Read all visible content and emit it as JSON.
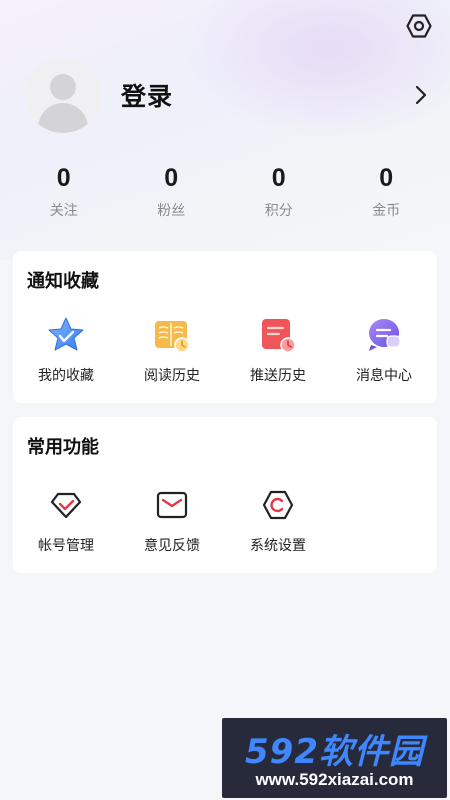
{
  "profile": {
    "login_label": "登录"
  },
  "stats": [
    {
      "value": "0",
      "label": "关注"
    },
    {
      "value": "0",
      "label": "粉丝"
    },
    {
      "value": "0",
      "label": "积分"
    },
    {
      "value": "0",
      "label": "金币"
    }
  ],
  "notify_section": {
    "title": "通知收藏",
    "items": [
      {
        "label": "我的收藏",
        "icon": "star-icon"
      },
      {
        "label": "阅读历史",
        "icon": "book-icon"
      },
      {
        "label": "推送历史",
        "icon": "push-history-icon"
      },
      {
        "label": "消息中心",
        "icon": "message-icon"
      }
    ]
  },
  "common_section": {
    "title": "常用功能",
    "items": [
      {
        "label": "帐号管理",
        "icon": "account-icon"
      },
      {
        "label": "意见反馈",
        "icon": "feedback-mail-icon"
      },
      {
        "label": "系统设置",
        "icon": "settings-hex-icon"
      }
    ]
  },
  "watermark": {
    "brand": "592软件园",
    "url": "www.592xiazai.com"
  },
  "colors": {
    "accent": "#e03a4a",
    "background": "#f5f6f9",
    "card": "#ffffff"
  }
}
